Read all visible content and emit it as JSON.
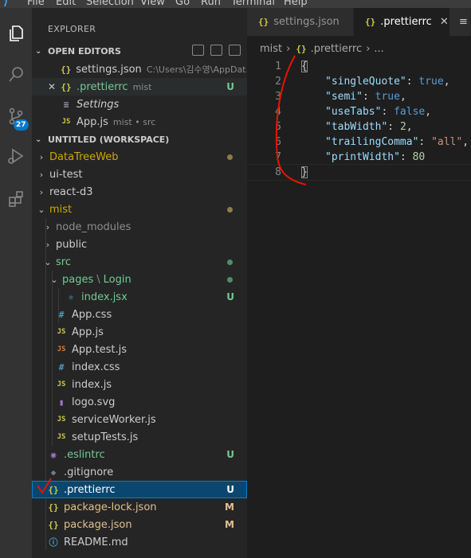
{
  "menu": {
    "items": [
      "File",
      "Edit",
      "Selection",
      "View",
      "Go",
      "Run",
      "Terminal",
      "Help"
    ]
  },
  "activity": {
    "scm_badge": "27"
  },
  "explorer": {
    "title": "EXPLORER",
    "open_editors": {
      "title": "OPEN EDITORS",
      "items": [
        {
          "name": "settings.json",
          "desc": "C:\\Users\\김수영\\AppDat...",
          "status": ""
        },
        {
          "name": ".prettierrc",
          "desc": "mist",
          "status": "U"
        },
        {
          "name": "Settings",
          "desc": "",
          "status": ""
        },
        {
          "name": "App.js",
          "desc": "mist • src",
          "status": ""
        }
      ]
    },
    "workspace": {
      "title": "UNTITLED (WORKSPACE)",
      "items": [
        {
          "name": "DataTreeWeb",
          "status": ""
        },
        {
          "name": "ui-test",
          "status": ""
        },
        {
          "name": "react-d3",
          "status": ""
        },
        {
          "name": "mist",
          "status": ""
        },
        {
          "name": "node_modules",
          "status": ""
        },
        {
          "name": "public",
          "status": ""
        },
        {
          "name": "src",
          "status": ""
        },
        {
          "name": "pages",
          "name2": "Login",
          "sep": "\\",
          "status": ""
        },
        {
          "name": "index.jsx",
          "status": "U"
        },
        {
          "name": "App.css",
          "status": ""
        },
        {
          "name": "App.js",
          "status": ""
        },
        {
          "name": "App.test.js",
          "status": ""
        },
        {
          "name": "index.css",
          "status": ""
        },
        {
          "name": "index.js",
          "status": ""
        },
        {
          "name": "logo.svg",
          "status": ""
        },
        {
          "name": "serviceWorker.js",
          "status": ""
        },
        {
          "name": "setupTests.js",
          "status": ""
        },
        {
          "name": ".eslintrc",
          "status": "U"
        },
        {
          "name": ".gitignore",
          "status": ""
        },
        {
          "name": ".prettierrc",
          "status": "U"
        },
        {
          "name": "package-lock.json",
          "status": "M"
        },
        {
          "name": "package.json",
          "status": "M"
        },
        {
          "name": "README.md",
          "status": ""
        }
      ]
    }
  },
  "icons": {
    "json": "{}",
    "js": "JS",
    "css": "#",
    "jsx": "⚛",
    "svg": "▮",
    "eslint": "◉",
    "git": "◆",
    "info": "ⓘ",
    "settings": "≡"
  },
  "editor": {
    "tabs": [
      {
        "label": "settings.json",
        "active": false
      },
      {
        "label": ".prettierrc",
        "active": true,
        "close": "✕"
      }
    ],
    "breadcrumb": {
      "folder": "mist",
      "file": ".prettierrc",
      "more": "..."
    },
    "lines": [
      {
        "n": "1",
        "tokens": [
          {
            "t": "{",
            "c": "p"
          }
        ]
      },
      {
        "n": "2",
        "tokens": [
          {
            "t": "\"singleQuote\"",
            "c": "k"
          },
          {
            "t": ": ",
            "c": "p"
          },
          {
            "t": "true",
            "c": "b"
          },
          {
            "t": ",",
            "c": "p"
          }
        ]
      },
      {
        "n": "3",
        "tokens": [
          {
            "t": "\"semi\"",
            "c": "k"
          },
          {
            "t": ": ",
            "c": "p"
          },
          {
            "t": "true",
            "c": "b"
          },
          {
            "t": ",",
            "c": "p"
          }
        ]
      },
      {
        "n": "4",
        "tokens": [
          {
            "t": "\"useTabs\"",
            "c": "k"
          },
          {
            "t": ": ",
            "c": "p"
          },
          {
            "t": "false",
            "c": "b"
          },
          {
            "t": ",",
            "c": "p"
          }
        ]
      },
      {
        "n": "5",
        "tokens": [
          {
            "t": "\"tabWidth\"",
            "c": "k"
          },
          {
            "t": ": ",
            "c": "p"
          },
          {
            "t": "2",
            "c": "n"
          },
          {
            "t": ",",
            "c": "p"
          }
        ]
      },
      {
        "n": "6",
        "tokens": [
          {
            "t": "\"trailingComma\"",
            "c": "k"
          },
          {
            "t": ": ",
            "c": "p"
          },
          {
            "t": "\"all\"",
            "c": "s"
          },
          {
            "t": ",",
            "c": "p"
          }
        ]
      },
      {
        "n": "7",
        "tokens": [
          {
            "t": "\"printWidth\"",
            "c": "k"
          },
          {
            "t": ": ",
            "c": "p"
          },
          {
            "t": "80",
            "c": "n"
          }
        ]
      },
      {
        "n": "8",
        "tokens": [
          {
            "t": "}",
            "c": "p"
          }
        ]
      }
    ]
  },
  "colors": {
    "accent": "#007acc",
    "selection": "#094771",
    "annotation": "#e51400"
  }
}
